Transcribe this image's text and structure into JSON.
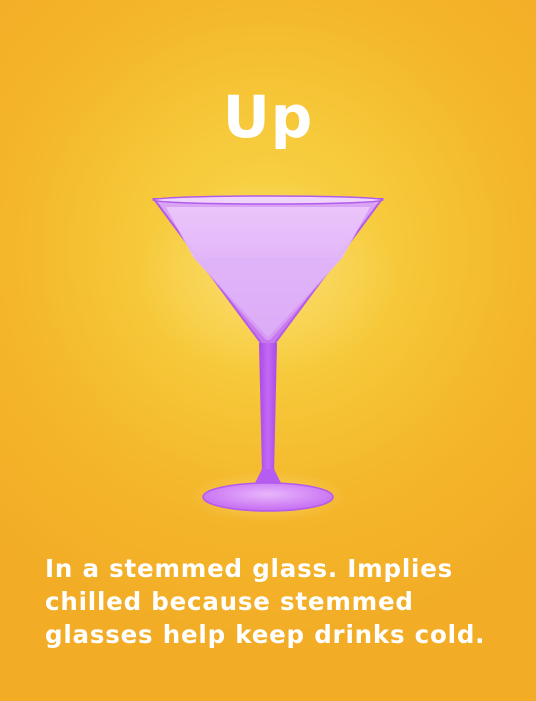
{
  "card": {
    "title": "Up",
    "caption": "In a stemmed glass. Implies\nchilled because stemmed\nglasses help keep drinks cold.",
    "icon": "martini-glass-icon"
  },
  "colors": {
    "background": "#f4b62a",
    "glass_purple": "#c45cf0",
    "glass_light": "#e6b8f8",
    "text": "#ffffff"
  }
}
